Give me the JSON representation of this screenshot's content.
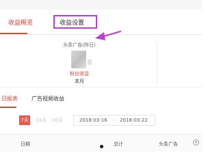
{
  "tabs": [
    {
      "label": "收益概览",
      "active": true
    },
    {
      "label": "收益设置",
      "active": false
    }
  ],
  "summary": {
    "title": "头条广告(昨日)",
    "fans_income_label": "粉丝收益",
    "this_month_label": "本月"
  },
  "subtabs": [
    {
      "label": "日报表",
      "active": true
    },
    {
      "label": "广告视频收益",
      "active": false
    }
  ],
  "filters": {
    "ranges": [
      {
        "label": "7天",
        "active": true
      },
      {
        "label": "14天",
        "active": false
      },
      {
        "label": "30天",
        "active": false
      }
    ],
    "date_start": "2018-03-16",
    "date_separator": "-",
    "date_end": "2018-03-22"
  },
  "table": {
    "columns": [
      "日期",
      "总计",
      "头条广告"
    ]
  },
  "icons": {
    "sort": "sort-icon",
    "annotation": "arrow-annotation-icon",
    "value_blur": "blurred-value-icon"
  },
  "colors": {
    "accent": "#e0453a",
    "annotation": "#b93fd6",
    "button_active": "#e8574a"
  }
}
